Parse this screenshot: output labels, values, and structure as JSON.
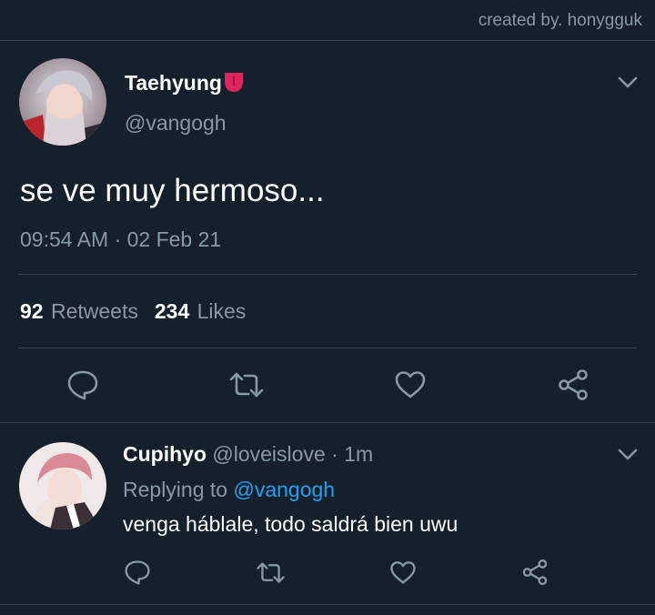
{
  "credit": "created by. honygguk",
  "tweet": {
    "name": "Taehyung",
    "emoji": "tongue-emoji",
    "handle": "@vangogh",
    "text": "se ve muy hermoso...",
    "timestamp": "09:54 AM · 02 Feb 21",
    "retweets_count": "92",
    "retweets_label": "Retweets",
    "likes_count": "234",
    "likes_label": "Likes",
    "actions": [
      "reply-icon",
      "retweet-icon",
      "like-icon",
      "share-icon"
    ]
  },
  "reply": {
    "name": "Cupihyo",
    "meta": "@loveislove · 1m",
    "replying_prefix": "Replying to",
    "replying_to": "@vangogh",
    "text": "venga háblale, todo saldrá bien uwu",
    "actions": [
      "reply-icon",
      "retweet-icon",
      "like-icon",
      "share-icon"
    ]
  },
  "colors": {
    "background": "#15202b",
    "secondary_text": "#8899a6",
    "divider": "#38444d",
    "link": "#1da1f2"
  }
}
